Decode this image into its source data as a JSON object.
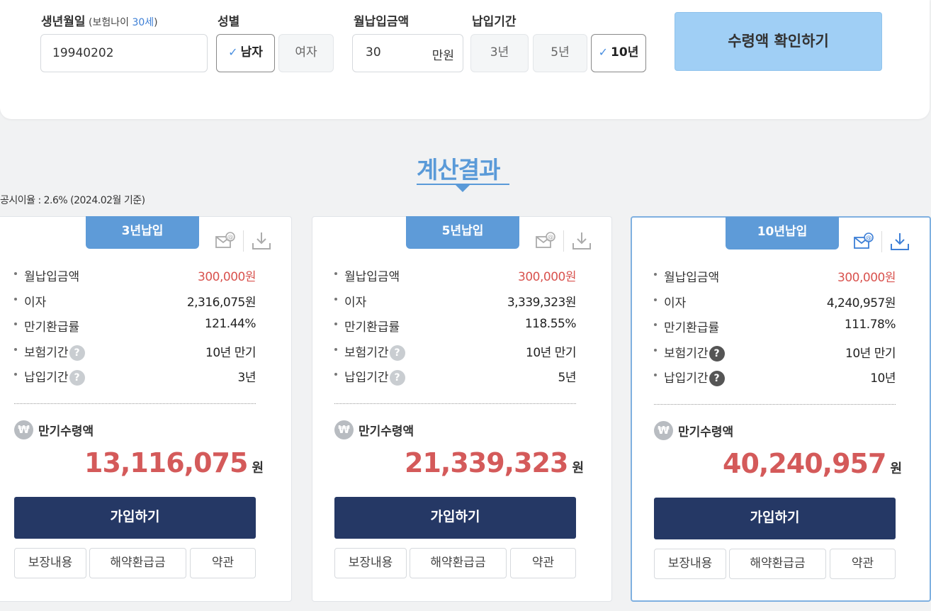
{
  "form": {
    "birth_label": "생년월일",
    "birth_sub_prefix": " (보험나이 ",
    "birth_age": "30세",
    "birth_sub_suffix": ")",
    "birth_value": "19940202",
    "gender_label": "성별",
    "gender_male": "남자",
    "gender_female": "여자",
    "gender_selected": "남자",
    "monthly_label": "월납입금액",
    "monthly_value": "30",
    "monthly_unit": "만원",
    "period_label": "납입기간",
    "periods": [
      "3년",
      "5년",
      "10년"
    ],
    "period_selected": "10년",
    "check_mark": "✓",
    "submit_label": "수령액 확인하기"
  },
  "results": {
    "title": "계산결과",
    "rate_note": "공시이율 : 2.6% (2024.02월 기준)"
  },
  "row_labels": {
    "monthly": "월납입금액",
    "interest": "이자",
    "refund_rate": "만기환급률",
    "coverage": "보험기간",
    "payment": "납입기간",
    "help": "?"
  },
  "maturity_label": "만기수령액",
  "won_symbol": "₩",
  "currency_unit": "원",
  "join_label": "가입하기",
  "sub_buttons": [
    "보장내용",
    "해약환급금",
    "약관"
  ],
  "cards": [
    {
      "tab": "3년납입",
      "monthly": "300,000원",
      "interest": "2,316,075원",
      "refund_rate": "121.44%",
      "coverage": "10년 만기",
      "payment": "3년",
      "maturity": "13,116,075"
    },
    {
      "tab": "5년납입",
      "monthly": "300,000원",
      "interest": "3,339,323원",
      "refund_rate": "118.55%",
      "coverage": "10년 만기",
      "payment": "5년",
      "maturity": "21,339,323"
    },
    {
      "tab": "10년납입",
      "monthly": "300,000원",
      "interest": "4,240,957원",
      "refund_rate": "111.78%",
      "coverage": "10년 만기",
      "payment": "10년",
      "maturity": "40,240,957"
    }
  ],
  "colors": {
    "accent_blue": "#5e9bd8",
    "submit_bg": "#a0cff5",
    "join_bg": "#253865",
    "amount_red": "#d45a5a"
  },
  "icons": {
    "email": "email-icon",
    "download": "download-icon",
    "help": "question-icon",
    "won": "won-icon",
    "check": "check-icon"
  }
}
